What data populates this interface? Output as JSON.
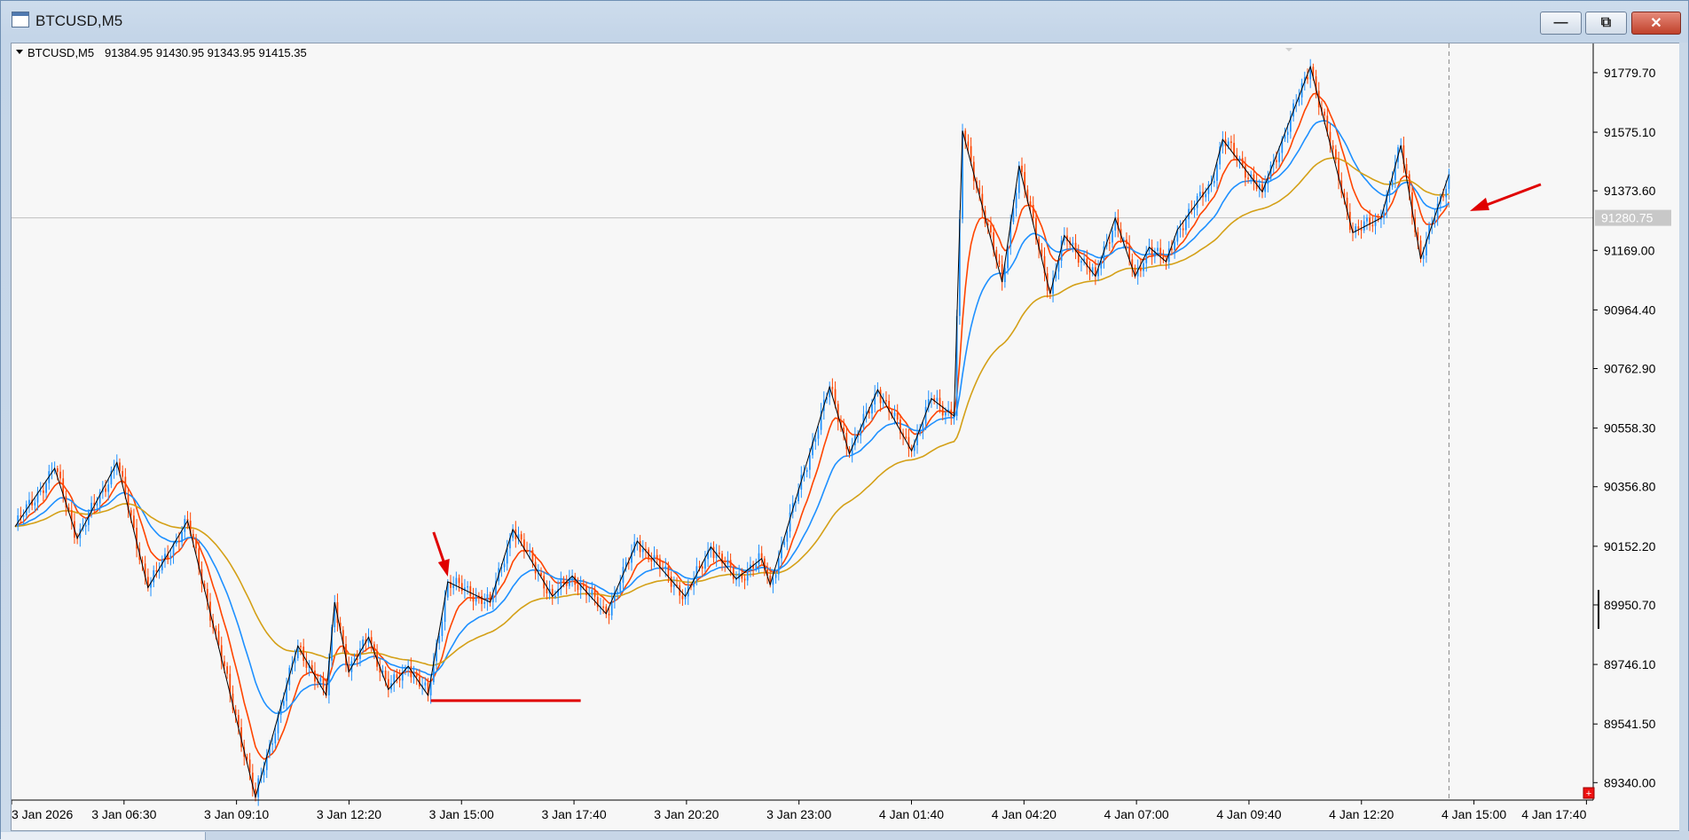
{
  "window": {
    "title": "BTCUSD,M5",
    "minimize_label": "—",
    "restore_label": "⧉",
    "close_label": "✕",
    "accent": "#4f79b0"
  },
  "chart_header": {
    "symbol": "BTCUSD,M5",
    "ohlc": "91384.95 91430.95 91343.95 91415.35"
  },
  "current_price": "91280.75",
  "colors": {
    "bull": "#1e90ff",
    "bear": "#ff4500",
    "ma_fast": "#ff4500",
    "ma_mid": "#1e90ff",
    "ma_slow": "#d4a017",
    "zigzag": "#000000",
    "annotation": "#e00000",
    "background": "#f7f7f7"
  },
  "chart_data": {
    "type": "line",
    "price_axis": [
      "91779.70",
      "91575.10",
      "91373.60",
      "91169.00",
      "90964.40",
      "90762.90",
      "90558.30",
      "90356.80",
      "90152.20",
      "89950.70",
      "89746.10",
      "89541.50",
      "89340.00"
    ],
    "time_axis": [
      "3 Jan 2026",
      "3 Jan 06:30",
      "3 Jan 09:10",
      "3 Jan 12:20",
      "3 Jan 15:00",
      "3 Jan 17:40",
      "3 Jan 20:20",
      "3 Jan 23:00",
      "4 Jan 01:40",
      "4 Jan 04:20",
      "4 Jan 07:00",
      "4 Jan 09:40",
      "4 Jan 12:20",
      "4 Jan 15:00",
      "4 Jan 17:40"
    ],
    "ylim": [
      89280,
      91880
    ],
    "zigzag": [
      {
        "t": 0,
        "p": 90220
      },
      {
        "t": 14,
        "p": 90420
      },
      {
        "t": 22,
        "p": 90180
      },
      {
        "t": 36,
        "p": 90440
      },
      {
        "t": 47,
        "p": 90010
      },
      {
        "t": 61,
        "p": 90240
      },
      {
        "t": 85,
        "p": 89290
      },
      {
        "t": 100,
        "p": 89810
      },
      {
        "t": 110,
        "p": 89640
      },
      {
        "t": 113,
        "p": 89960
      },
      {
        "t": 118,
        "p": 89720
      },
      {
        "t": 125,
        "p": 89840
      },
      {
        "t": 132,
        "p": 89660
      },
      {
        "t": 139,
        "p": 89740
      },
      {
        "t": 146,
        "p": 89640
      },
      {
        "t": 153,
        "p": 90030
      },
      {
        "t": 168,
        "p": 89960
      },
      {
        "t": 176,
        "p": 90210
      },
      {
        "t": 190,
        "p": 89980
      },
      {
        "t": 197,
        "p": 90050
      },
      {
        "t": 209,
        "p": 89920
      },
      {
        "t": 220,
        "p": 90170
      },
      {
        "t": 237,
        "p": 89980
      },
      {
        "t": 246,
        "p": 90150
      },
      {
        "t": 255,
        "p": 90040
      },
      {
        "t": 264,
        "p": 90110
      },
      {
        "t": 267,
        "p": 90020
      },
      {
        "t": 288,
        "p": 90700
      },
      {
        "t": 295,
        "p": 90470
      },
      {
        "t": 305,
        "p": 90690
      },
      {
        "t": 317,
        "p": 90480
      },
      {
        "t": 324,
        "p": 90660
      },
      {
        "t": 332,
        "p": 90600
      },
      {
        "t": 335,
        "p": 91580
      },
      {
        "t": 349,
        "p": 91060
      },
      {
        "t": 355,
        "p": 91460
      },
      {
        "t": 366,
        "p": 91020
      },
      {
        "t": 371,
        "p": 91220
      },
      {
        "t": 382,
        "p": 91080
      },
      {
        "t": 389,
        "p": 91280
      },
      {
        "t": 396,
        "p": 91080
      },
      {
        "t": 401,
        "p": 91180
      },
      {
        "t": 407,
        "p": 91130
      },
      {
        "t": 411,
        "p": 91240
      },
      {
        "t": 423,
        "p": 91400
      },
      {
        "t": 427,
        "p": 91550
      },
      {
        "t": 441,
        "p": 91370
      },
      {
        "t": 458,
        "p": 91800
      },
      {
        "t": 473,
        "p": 91230
      },
      {
        "t": 483,
        "p": 91280
      },
      {
        "t": 490,
        "p": 91530
      },
      {
        "t": 497,
        "p": 91140
      },
      {
        "t": 507,
        "p": 91430
      }
    ],
    "annotations": [
      {
        "type": "arrow",
        "label": "down-arrow",
        "at_t": 153,
        "at_p": 90030
      },
      {
        "type": "arrow",
        "label": "left-arrow",
        "at_t": 510,
        "at_p": 91280
      },
      {
        "type": "hline",
        "from_t": 147,
        "to_t": 200,
        "p": 89640
      }
    ]
  }
}
